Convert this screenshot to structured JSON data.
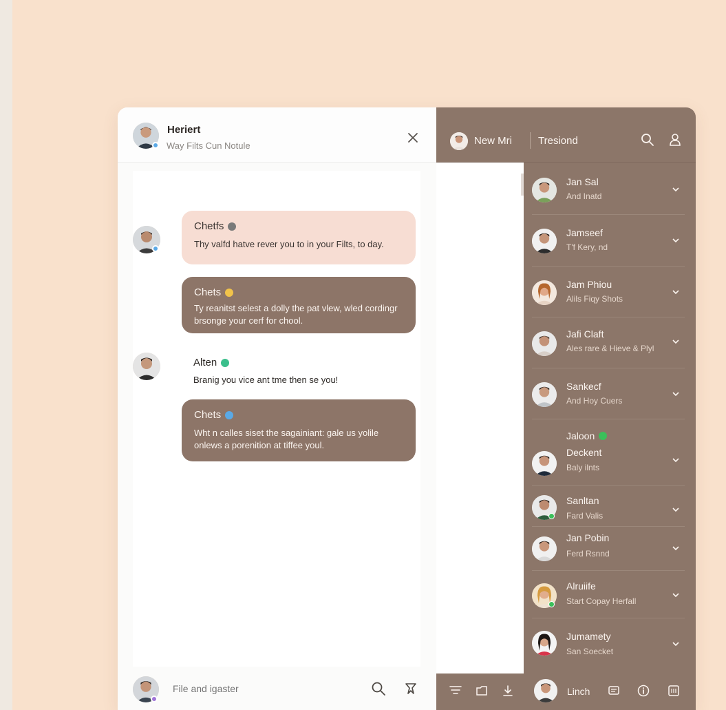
{
  "colors": {
    "page_bg": "#f9e1cc",
    "accent_brown": "#8c7669",
    "bubble_light": "#f7ddd3",
    "bubble_dark": "#8d7568"
  },
  "chat": {
    "header": {
      "name": "Heriert",
      "subtitle": "Way Filts Cun Notule",
      "close_icon": "close-icon"
    },
    "messages": [
      {
        "title": "Chetfs",
        "text": "Thy valfd hatve rever you to in your Filts, to day.",
        "style": "light",
        "badge": "#7a7a7a"
      },
      {
        "title": "Chets",
        "text": "Ty reanitst selest a dolly the pat vlew, wled cordingr brsonge your cerf for chool.",
        "style": "dark",
        "badge": "#f1c34a"
      },
      {
        "title": "Alten",
        "text": "Branig you vice ant tme then se you!",
        "style": "plain",
        "badge": "#3bbf8c"
      },
      {
        "title": "Chets",
        "text": "Wht n calles siset the sagainiant: gale us yolile onlews a porenition at tiffee youl.",
        "style": "dark",
        "badge": "#5aa9e6"
      }
    ],
    "footer": {
      "placeholder": "File and igaster",
      "search_icon": "search-icon",
      "pin_icon": "pin-icon"
    }
  },
  "side": {
    "header": {
      "new_label": "New Mri",
      "tab_label": "Tresiond",
      "search_icon": "search-icon",
      "user_icon": "user-icon"
    },
    "contacts": [
      {
        "name": "Jan Sal",
        "sub": "And Inatd"
      },
      {
        "name": "Jamseef",
        "sub": "T'f Kery, nd"
      },
      {
        "name": "Jam Phiou",
        "sub": "Alils Fiqy Shots"
      },
      {
        "name": "Jafi Claft",
        "sub": "Ales rare & Hieve & Plyl"
      },
      {
        "name": "Sankecf",
        "sub": "And Hoy Cuers"
      },
      {
        "name": "Jaloon",
        "name2": "Deckent",
        "sub": "Baly ilnts",
        "badge": "#3bbf5a"
      },
      {
        "name": "Sanltan",
        "sub": "Fard Valis"
      },
      {
        "name": "Jan Pobin",
        "sub": "Ferd Rsnnd"
      },
      {
        "name": "Alruiife",
        "sub": "Start Copay Herfall"
      },
      {
        "name": "Jumamety",
        "sub": "San Soecket"
      }
    ],
    "footer": {
      "user_label": "Linch"
    }
  }
}
